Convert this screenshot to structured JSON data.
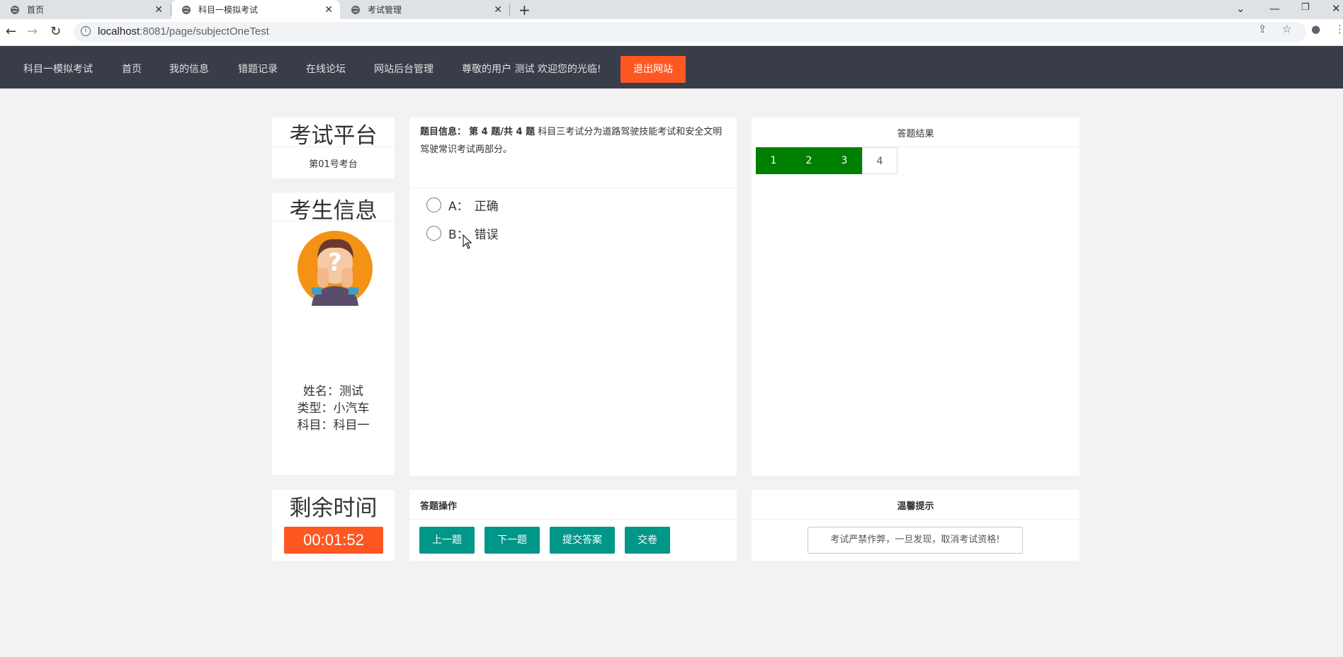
{
  "browser": {
    "tabs": [
      {
        "title": "首页"
      },
      {
        "title": "科目一模拟考试"
      },
      {
        "title": "考试管理"
      }
    ],
    "url_host": "localhost",
    "url_rest": ":8081/page/subjectOneTest"
  },
  "nav": {
    "brand": "科目一模拟考试",
    "items": [
      "首页",
      "我的信息",
      "错题记录",
      "在线论坛",
      "网站后台管理"
    ],
    "welcome": "尊敬的用户 测试 欢迎您的光临!",
    "logout": "退出网站"
  },
  "platform": {
    "title": "考试平台",
    "station": "第01号考台"
  },
  "student": {
    "title": "考生信息",
    "name_line": "姓名：测试",
    "type_line": "类型：小汽车",
    "subject_line": "科目：科目一"
  },
  "timer": {
    "title": "剩余时间",
    "value": "00:01:52"
  },
  "question": {
    "label": "题目信息：",
    "progress": "第 4 题/共 4 题",
    "text": "科目三考试分为道路驾驶技能考试和安全文明驾驶常识考试两部分。",
    "options": [
      {
        "key": "A：",
        "text": "正确"
      },
      {
        "key": "B：",
        "text": "错误"
      }
    ]
  },
  "results": {
    "title": "答题结果",
    "items": [
      {
        "num": "1",
        "done": true
      },
      {
        "num": "2",
        "done": true
      },
      {
        "num": "3",
        "done": true
      },
      {
        "num": "4",
        "done": false
      }
    ]
  },
  "operations": {
    "title": "答题操作",
    "prev": "上一题",
    "next": "下一题",
    "submit": "提交答案",
    "hand_in": "交卷"
  },
  "tips": {
    "title": "温馨提示",
    "text": "考试严禁作弊，一旦发现，取消考试资格!"
  },
  "colors": {
    "nav_bg": "#393d49",
    "danger": "#ff5722",
    "teal": "#009688",
    "done_green": "#008000"
  }
}
